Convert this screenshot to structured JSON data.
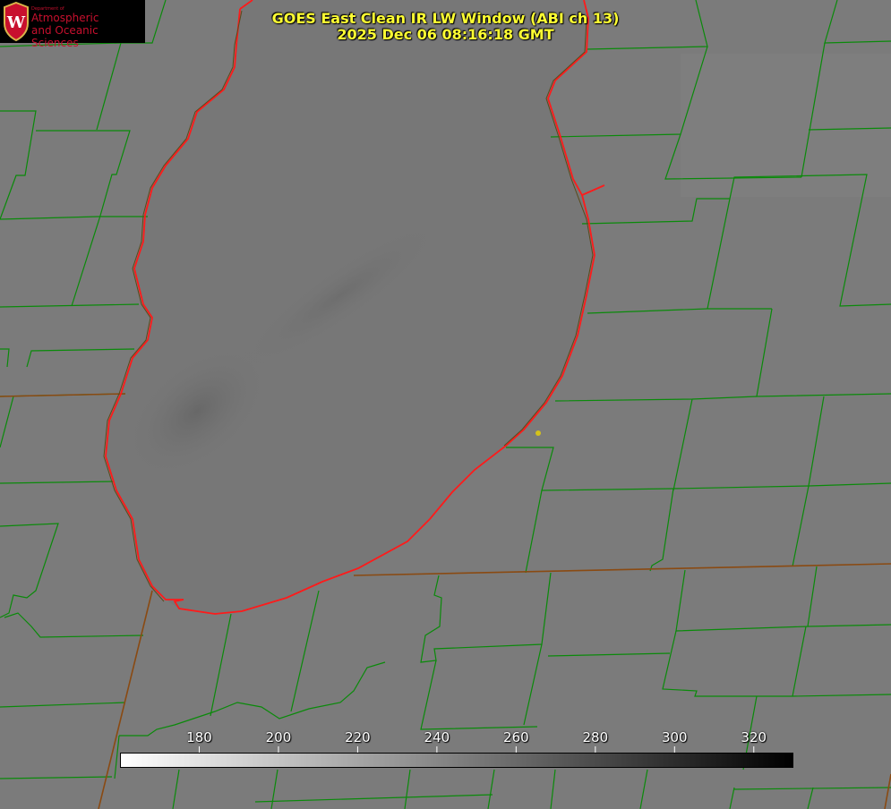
{
  "logo": {
    "dept_label": "Department of",
    "line1": "Atmospheric",
    "line2": "and Oceanic Sciences"
  },
  "title": {
    "line1": "GOES East Clean IR LW Window (ABI ch 13)",
    "line2": "2025 Dec 06 08:16:18 GMT"
  },
  "colorbar": {
    "min": 160,
    "max": 330,
    "ticks": [
      "180",
      "200",
      "220",
      "240",
      "260",
      "280",
      "300",
      "320"
    ],
    "color_low": "#ffffff",
    "color_high": "#000000"
  },
  "map_colors": {
    "background_gray": "#7a7a7a",
    "lake_gray": "#777777",
    "county_lines": "#0a8a0a",
    "state_lines": "#8a4a12",
    "lake_outline": "#ff1a1a",
    "marker": "#d4c21a"
  }
}
